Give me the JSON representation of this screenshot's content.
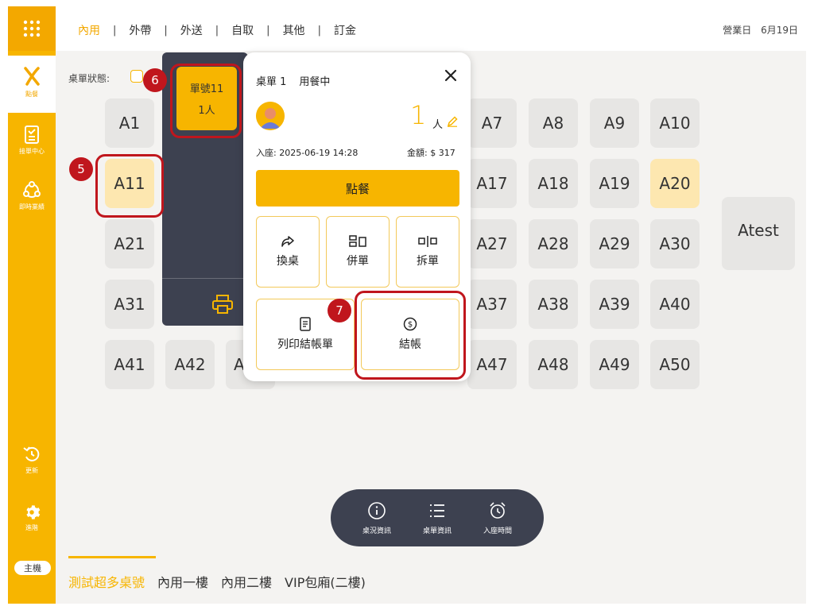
{
  "topbar": {
    "tabs": [
      {
        "label": "內用",
        "active": true
      },
      {
        "label": "外帶",
        "active": false
      },
      {
        "label": "外送",
        "active": false
      },
      {
        "label": "自取",
        "active": false
      },
      {
        "label": "其他",
        "active": false
      },
      {
        "label": "訂金",
        "active": false
      }
    ],
    "separator": "|",
    "business_day_label": "營業日",
    "business_day_value": "6月19日"
  },
  "sidebar": {
    "items": [
      {
        "label": "點餐",
        "icon": "brand-x-icon"
      },
      {
        "label": "接單中心",
        "icon": "clipboard-icon"
      },
      {
        "label": "即時業績",
        "icon": "network-icon"
      },
      {
        "label": "更新",
        "icon": "refresh-icon"
      },
      {
        "label": "進階",
        "icon": "gear-icon"
      }
    ],
    "host_badge": "主機"
  },
  "status_label": "桌單狀態:",
  "tables": [
    {
      "label": "A1"
    },
    {
      "label": "A7"
    },
    {
      "label": "A8"
    },
    {
      "label": "A9"
    },
    {
      "label": "A10"
    },
    {
      "label": "A11"
    },
    {
      "label": "A17"
    },
    {
      "label": "A18"
    },
    {
      "label": "A19"
    },
    {
      "label": "A20"
    },
    {
      "label": "A21"
    },
    {
      "label": "A27"
    },
    {
      "label": "A28"
    },
    {
      "label": "A29"
    },
    {
      "label": "A30"
    },
    {
      "label": "A31"
    },
    {
      "label": "A37"
    },
    {
      "label": "A38"
    },
    {
      "label": "A39"
    },
    {
      "label": "A40"
    },
    {
      "label": "A41"
    },
    {
      "label": "A42"
    },
    {
      "label": "A"
    },
    {
      "label": "A47"
    },
    {
      "label": "A48"
    },
    {
      "label": "A49"
    },
    {
      "label": "A50"
    },
    {
      "label": "Atest"
    }
  ],
  "order_card": {
    "title": "單號11",
    "people": "1人"
  },
  "popup": {
    "table_label": "桌單 1",
    "status": "用餐中",
    "people_count": "1",
    "people_unit": "人",
    "seated": "入座: 2025-06-19 14:28",
    "amount": "金額: $ 317",
    "order_button": "點餐",
    "actions": [
      {
        "label": "換桌",
        "icon": "share-arrow-icon"
      },
      {
        "label": "併單",
        "icon": "merge-icon"
      },
      {
        "label": "拆單",
        "icon": "split-icon"
      },
      {
        "label": "列印結帳單",
        "icon": "receipt-icon"
      },
      {
        "label": "結帳",
        "icon": "dollar-coin-icon"
      }
    ]
  },
  "callouts": [
    "5",
    "6",
    "7"
  ],
  "bottom_bar": {
    "items": [
      {
        "label": "桌況資訊",
        "icon": "info-icon"
      },
      {
        "label": "桌單資訊",
        "icon": "list-icon"
      },
      {
        "label": "入座時間",
        "icon": "alarm-clock-icon"
      }
    ]
  },
  "floor_tabs": [
    {
      "label": "測試超多桌號",
      "active": true
    },
    {
      "label": "內用一樓",
      "active": false
    },
    {
      "label": "內用二樓",
      "active": false
    },
    {
      "label": "VIP包廂(二樓)",
      "active": false
    }
  ],
  "colors": {
    "accent": "#f7b500",
    "dark": "#3d4150",
    "callout": "#c0161d",
    "highlight": "#fde7b0"
  }
}
